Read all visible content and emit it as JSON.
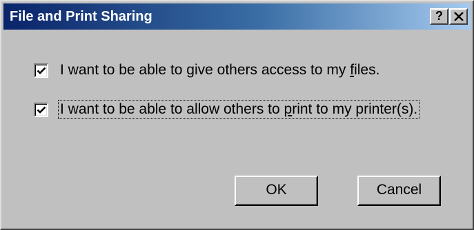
{
  "window": {
    "title": "File and Print Sharing",
    "help_label": "?"
  },
  "options": [
    {
      "checked": true,
      "label_before": "I want to be able to give others access to my ",
      "label_mnemonic": "f",
      "label_after": "iles."
    },
    {
      "checked": true,
      "label_before": "I want to be able to allow others to ",
      "label_mnemonic": "p",
      "label_after": "rint to my printer(s)."
    }
  ],
  "buttons": {
    "ok_label": "OK",
    "cancel_label": "Cancel"
  },
  "icons": {
    "help": "help-icon",
    "close": "close-icon",
    "check": "checkmark-icon"
  }
}
